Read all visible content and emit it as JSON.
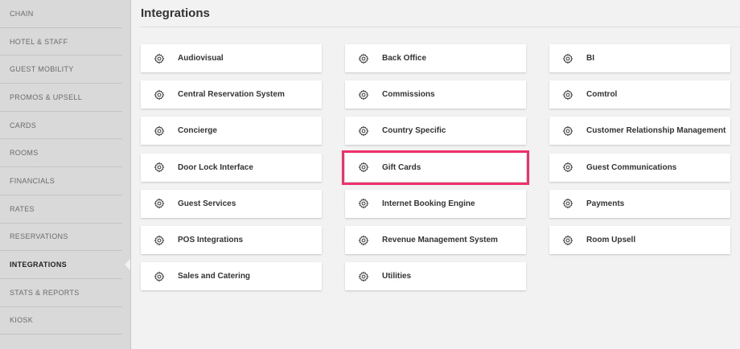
{
  "sidebar": {
    "items": [
      {
        "label": "CHAIN",
        "active": false
      },
      {
        "label": "HOTEL & STAFF",
        "active": false
      },
      {
        "label": "GUEST MOBILITY",
        "active": false
      },
      {
        "label": "PROMOS & UPSELL",
        "active": false
      },
      {
        "label": "CARDS",
        "active": false
      },
      {
        "label": "ROOMS",
        "active": false
      },
      {
        "label": "FINANCIALS",
        "active": false
      },
      {
        "label": "RATES",
        "active": false
      },
      {
        "label": "RESERVATIONS",
        "active": false
      },
      {
        "label": "INTEGRATIONS",
        "active": true
      },
      {
        "label": "STATS & REPORTS",
        "active": false
      },
      {
        "label": "KIOSK",
        "active": false
      }
    ]
  },
  "main": {
    "title": "Integrations",
    "cards": [
      {
        "label": "Audiovisual",
        "icon": "gear-icon"
      },
      {
        "label": "Back Office",
        "icon": "gear-icon"
      },
      {
        "label": "BI",
        "icon": "gear-icon"
      },
      {
        "label": "Central Reservation System",
        "icon": "gear-icon"
      },
      {
        "label": "Commissions",
        "icon": "gear-icon"
      },
      {
        "label": "Comtrol",
        "icon": "gear-icon"
      },
      {
        "label": "Concierge",
        "icon": "gear-icon"
      },
      {
        "label": "Country Specific",
        "icon": "gear-icon"
      },
      {
        "label": "Customer Relationship Management",
        "icon": "gear-icon"
      },
      {
        "label": "Door Lock Interface",
        "icon": "gear-icon"
      },
      {
        "label": "Gift Cards",
        "icon": "gear-icon",
        "highlighted": true
      },
      {
        "label": "Guest Communications",
        "icon": "gear-icon"
      },
      {
        "label": "Guest Services",
        "icon": "gear-icon"
      },
      {
        "label": "Internet Booking Engine",
        "icon": "gear-icon"
      },
      {
        "label": "Payments",
        "icon": "gear-icon"
      },
      {
        "label": "POS Integrations",
        "icon": "gear-icon"
      },
      {
        "label": "Revenue Management System",
        "icon": "gear-icon"
      },
      {
        "label": "Room Upsell",
        "icon": "gear-icon"
      },
      {
        "label": "Sales and Catering",
        "icon": "gear-icon"
      },
      {
        "label": "Utilities",
        "icon": "gear-icon"
      }
    ]
  },
  "colors": {
    "highlight": "#f0306a",
    "sidebar_bg": "#d9d9d9",
    "page_bg": "#f2f2f2"
  }
}
